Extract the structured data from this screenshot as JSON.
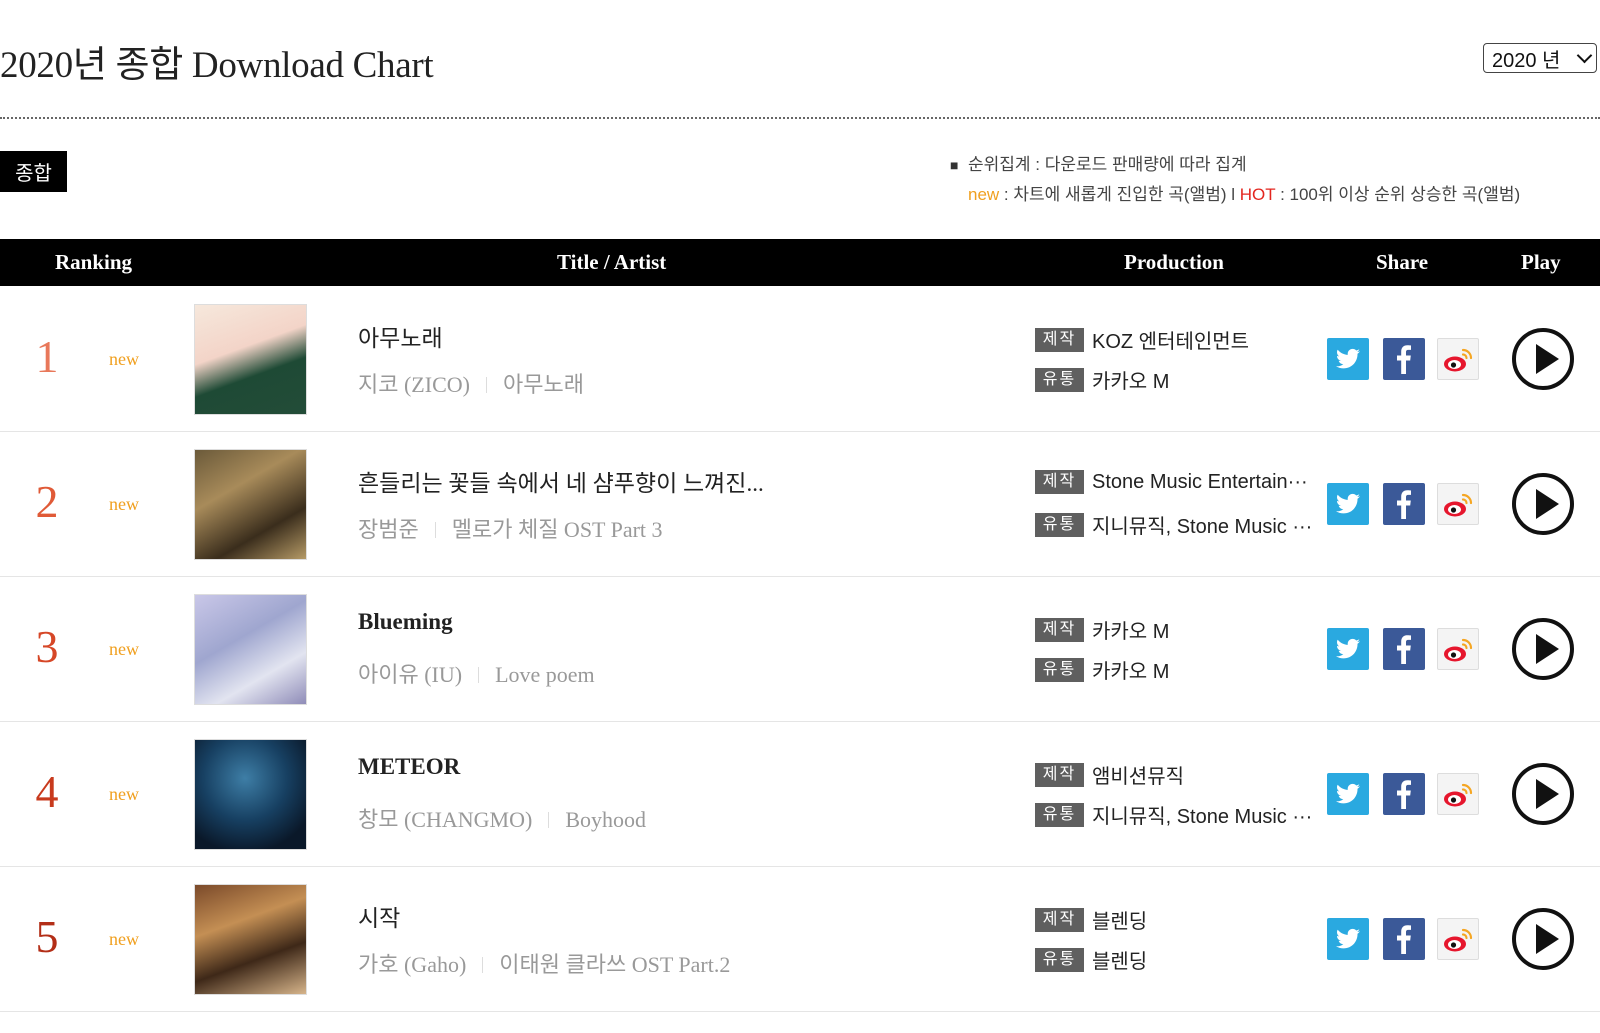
{
  "header": {
    "title": "2020년 종합 Download Chart",
    "year_select": "2020 년"
  },
  "category_tab": "종합",
  "notes": {
    "line1": "순위집계 : 다운로드 판매량에 따라 집계",
    "new_word": "new",
    "new_desc": " : 차트에 새롭게 진입한 곡(앨범) l ",
    "hot_word": "HOT",
    "hot_desc": " : 100위 이상 순위 상승한 곡(앨범)"
  },
  "table_header": {
    "ranking": "Ranking",
    "title_artist": "Title / Artist",
    "production": "Production",
    "share": "Share",
    "play": "Play"
  },
  "production_labels": {
    "maker": "제작",
    "distributor": "유통"
  },
  "rows": [
    {
      "rank": "1",
      "tag": "new",
      "title": "아무노래",
      "artist": "지코 (ZICO)",
      "album": "아무노래",
      "maker": "KOZ 엔터테인먼트",
      "distributor": "카카오 M"
    },
    {
      "rank": "2",
      "tag": "new",
      "title": "흔들리는 꽃들 속에서 네 샴푸향이 느껴진...",
      "artist": "장범준",
      "album": "멜로가 체질 OST Part 3",
      "maker": "Stone Music Entertain···",
      "distributor": "지니뮤직, Stone Music ···"
    },
    {
      "rank": "3",
      "tag": "new",
      "title": "Blueming",
      "artist": "아이유 (IU)",
      "album": "Love poem",
      "maker": "카카오 M",
      "distributor": "카카오 M"
    },
    {
      "rank": "4",
      "tag": "new",
      "title": "METEOR",
      "artist": "창모 (CHANGMO)",
      "album": "Boyhood",
      "maker": "앰비션뮤직",
      "distributor": "지니뮤직, Stone Music ···"
    },
    {
      "rank": "5",
      "tag": "new",
      "title": "시작",
      "artist": "가호 (Gaho)",
      "album": "이태원 클라쓰 OST Part.2",
      "maker": "블렌딩",
      "distributor": "블렌딩"
    }
  ],
  "colors": {
    "rank_colors": [
      "#e8785a",
      "#e05a37",
      "#d64727",
      "#c83a1d",
      "#b32e17"
    ],
    "new_tag": "#f0a020",
    "hot_tag": "#e3261f",
    "twitter": "#2aa9e0",
    "facebook": "#3b5998"
  },
  "icons": {
    "share": [
      "twitter-icon",
      "facebook-icon",
      "weibo-icon"
    ],
    "play": "play-circle-icon"
  }
}
